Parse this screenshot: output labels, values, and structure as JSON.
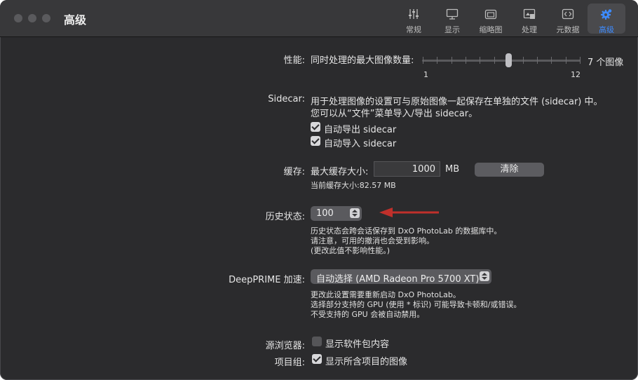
{
  "window": {
    "title": "高级"
  },
  "toolbar": [
    {
      "label": "常规",
      "icon": "sliders-icon"
    },
    {
      "label": "显示",
      "icon": "display-icon"
    },
    {
      "label": "缩略图",
      "icon": "thumbnails-icon"
    },
    {
      "label": "处理",
      "icon": "processing-icon"
    },
    {
      "label": "元数据",
      "icon": "metadata-icon"
    },
    {
      "label": "高级",
      "icon": "gear-icon",
      "active": true
    }
  ],
  "performance": {
    "label": "性能:",
    "desc": "同时处理的最大图像数量:",
    "value_text": "7 个图像",
    "min_label": "1",
    "max_label": "12",
    "value": 7,
    "min": 1,
    "max": 12
  },
  "sidecar": {
    "label": "Sidecar:",
    "line1": "用于处理图像的设置可与原始图像一起保存在单独的文件 (sidecar) 中。",
    "line2": "您可以从“文件”菜单导入/导出 sidecar。",
    "export_label": "自动导出 sidecar",
    "export_checked": true,
    "import_label": "自动导入 sidecar",
    "import_checked": true
  },
  "cache": {
    "label": "缓存:",
    "max_label": "最大缓存大小:",
    "value": "1000",
    "unit": "MB",
    "clear_button": "清除",
    "current": "当前缓存大小:82.57 MB"
  },
  "history": {
    "label": "历史状态:",
    "value": "100",
    "note1": "历史状态会跨会话保存到 DxO PhotoLab 的数据库中。",
    "note2": "请注意，可用的撤消也会受到影响。",
    "note3": "(更改此值不影响性能。)",
    "arrow_color": "#c0302b"
  },
  "deepprime": {
    "label": "DeepPRIME 加速:",
    "value": "自动选择 (AMD Radeon Pro 5700 XT)",
    "note1": "更改此设置需要重新启动 DxO PhotoLab。",
    "note2": "选择部分支持的 GPU (使用 * 标识) 可能导致卡顿和/或错误。",
    "note3": "不受支持的 GPU 会被自动禁用。"
  },
  "browser": {
    "label": "源浏览器:",
    "option": "显示软件包内容",
    "checked": false
  },
  "project": {
    "label": "项目组:",
    "option": "显示所含项目的图像",
    "checked": true
  },
  "colors": {
    "accent": "#3d8bff",
    "background": "#2b2b2d"
  }
}
